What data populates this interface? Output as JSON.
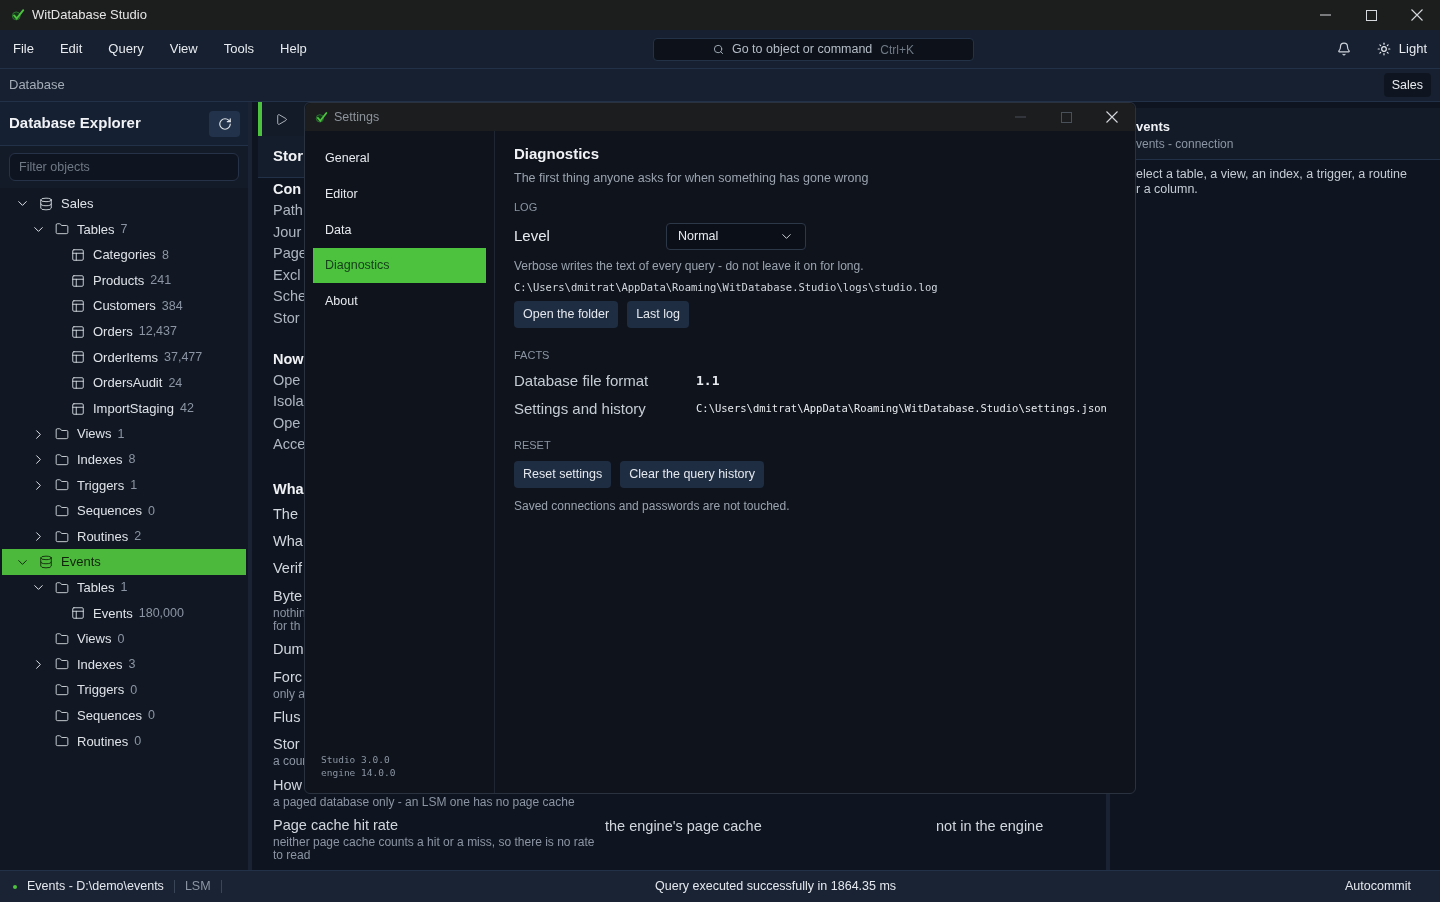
{
  "window": {
    "title": "WitDatabase Studio"
  },
  "menu": [
    "File",
    "Edit",
    "Query",
    "View",
    "Tools",
    "Help"
  ],
  "command_search": {
    "placeholder": "Go to object or command",
    "shortcut": "Ctrl+K"
  },
  "theme_toggle": {
    "label": "Light"
  },
  "breadcrumb": {
    "label": "Database",
    "database_tag": "Sales"
  },
  "explorer": {
    "title": "Database Explorer",
    "filter": {
      "placeholder": "Filter objects"
    },
    "tree": [
      {
        "kind": "database",
        "label": "Sales",
        "expanded": true,
        "selected": false,
        "children": [
          {
            "kind": "folder",
            "label": "Tables",
            "count": "7",
            "expanded": true,
            "selected": false,
            "children": [
              {
                "kind": "table",
                "label": "Categories",
                "count": "8",
                "selected": false
              },
              {
                "kind": "table",
                "label": "Products",
                "count": "241",
                "selected": false
              },
              {
                "kind": "table",
                "label": "Customers",
                "count": "384",
                "selected": false
              },
              {
                "kind": "table",
                "label": "Orders",
                "count": "12,437",
                "selected": false
              },
              {
                "kind": "table",
                "label": "OrderItems",
                "count": "37,477",
                "selected": false
              },
              {
                "kind": "table",
                "label": "OrdersAudit",
                "count": "24",
                "selected": false
              },
              {
                "kind": "table",
                "label": "ImportStaging",
                "count": "42",
                "selected": false
              }
            ]
          },
          {
            "kind": "folder",
            "label": "Views",
            "count": "1",
            "expanded": false,
            "selected": false
          },
          {
            "kind": "folder",
            "label": "Indexes",
            "count": "8",
            "expanded": false,
            "selected": false
          },
          {
            "kind": "folder",
            "label": "Triggers",
            "count": "1",
            "expanded": false,
            "selected": false
          },
          {
            "kind": "folder",
            "label": "Sequences",
            "count": "0",
            "selected": false
          },
          {
            "kind": "folder",
            "label": "Routines",
            "count": "2",
            "expanded": false,
            "selected": false
          }
        ]
      },
      {
        "kind": "database",
        "label": "Events",
        "expanded": true,
        "selected": true,
        "children": [
          {
            "kind": "folder",
            "label": "Tables",
            "count": "1",
            "expanded": true,
            "selected": false,
            "children": [
              {
                "kind": "table",
                "label": "Events",
                "count": "180,000",
                "selected": false
              }
            ]
          },
          {
            "kind": "folder",
            "label": "Views",
            "count": "0",
            "selected": false
          },
          {
            "kind": "folder",
            "label": "Indexes",
            "count": "3",
            "expanded": false,
            "selected": false
          },
          {
            "kind": "folder",
            "label": "Triggers",
            "count": "0",
            "selected": false
          },
          {
            "kind": "folder",
            "label": "Sequences",
            "count": "0",
            "selected": false
          },
          {
            "kind": "folder",
            "label": "Routines",
            "count": "0",
            "selected": false
          }
        ]
      }
    ]
  },
  "storage_panel": {
    "header": "Stor",
    "sections": [
      {
        "kind": "list",
        "heading": "Con",
        "rows": [
          {
            "label": "Path"
          },
          {
            "label": "Jour"
          },
          {
            "label": "Page"
          },
          {
            "label": "Excl"
          },
          {
            "label": "Sche"
          },
          {
            "label": "Stor"
          }
        ]
      },
      {
        "kind": "list",
        "heading": "Now",
        "rows": [
          {
            "label": "Ope"
          },
          {
            "label": "Isola"
          },
          {
            "label": "Ope"
          },
          {
            "label": "Acce"
          }
        ]
      },
      {
        "kind": "table",
        "heading": "Wha",
        "rows": [
          {
            "label": "The"
          },
          {
            "label": "Wha"
          },
          {
            "label": "Verif"
          },
          {
            "label": "Byte",
            "note": [
              "nothin",
              "for th"
            ]
          },
          {
            "label": "Dum"
          },
          {
            "label": "Forc",
            "note": [
              "only a"
            ]
          },
          {
            "label": "Flus"
          },
          {
            "label": "Stor",
            "note": [
              "a cour"
            ]
          },
          {
            "label": "How",
            "note": [
              "a paged database only - an LSM one has no page cache"
            ]
          },
          {
            "label": "Page cache hit rate",
            "note": [
              "neither page cache counts a hit or a miss, so there is no rate",
              "to read"
            ],
            "column_2": "the engine's page cache",
            "column_3": "not in the engine"
          }
        ]
      }
    ]
  },
  "inspector": {
    "title": "vents",
    "subtitle": "vents - connection",
    "hint": [
      "elect a table, a view, an index, a trigger, a routine",
      "r a column."
    ]
  },
  "settings_dialog": {
    "title": "Settings",
    "window_controls": [
      {
        "kind": "minimize",
        "disabled": true
      },
      {
        "kind": "maximize",
        "disabled": true
      },
      {
        "kind": "close",
        "disabled": false
      }
    ],
    "nav": [
      {
        "label": "General",
        "selected": false
      },
      {
        "label": "Editor",
        "selected": false
      },
      {
        "label": "Data",
        "selected": false
      },
      {
        "label": "Diagnostics",
        "selected": true
      },
      {
        "label": "About",
        "selected": false
      }
    ],
    "version_lines": [
      "Studio 3.0.0",
      "engine 14.0.0"
    ],
    "page": {
      "title": "Diagnostics",
      "subtitle": "The first thing anyone asks for when something has gone wrong",
      "log": {
        "heading": "LOG",
        "level_label": "Level",
        "level_value": "Normal",
        "hint": "Verbose writes the text of every query - do not leave it on for long.",
        "path": "C:\\Users\\dmitrat\\AppData\\Roaming\\WitDatabase.Studio\\logs\\studio.log",
        "buttons": [
          "Open the folder",
          "Last log"
        ]
      },
      "facts": {
        "heading": "FACTS",
        "rows": [
          {
            "label": "Database file format",
            "value": "1.1",
            "emphasis": true
          },
          {
            "label": "Settings and history",
            "value": "C:\\Users\\dmitrat\\AppData\\Roaming\\WitDatabase.Studio\\settings.json",
            "emphasis": false
          }
        ]
      },
      "reset": {
        "heading": "RESET",
        "buttons": [
          "Reset settings",
          "Clear the query history"
        ],
        "note": "Saved connections and passwords are not touched."
      }
    }
  },
  "status_bar": {
    "connection": "Events - D:\\demo\\events",
    "engine": "LSM",
    "message": "Query executed successfully in 1864.35 ms",
    "mode": "Autocommit"
  }
}
